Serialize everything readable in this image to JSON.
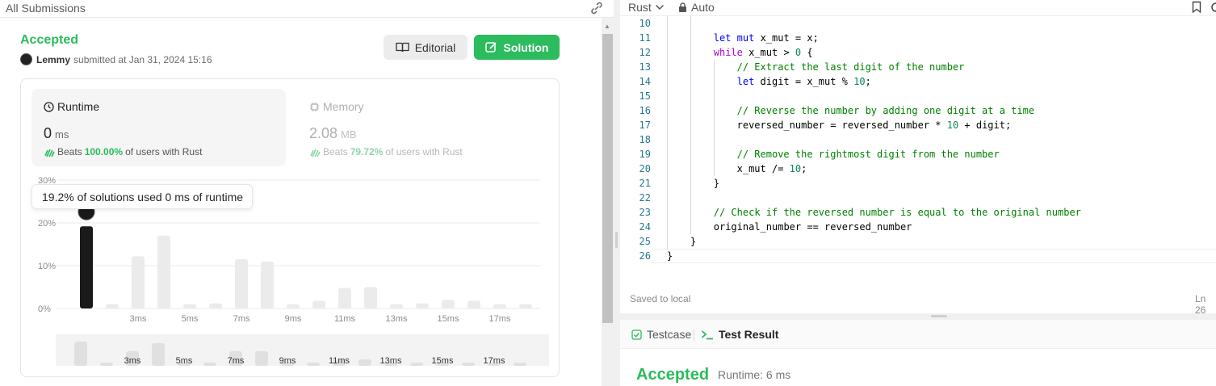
{
  "left_panel": {
    "header_title": "All Submissions",
    "status": "Accepted",
    "user_name": "Lemmy",
    "submitted_text": "submitted at Jan 31, 2024 15:16",
    "editorial_label": "Editorial",
    "solution_label": "Solution",
    "runtime": {
      "heading": "Runtime",
      "value": "0",
      "unit": "ms",
      "beats_prefix": "Beats",
      "beats_pct": "100.00%",
      "beats_suffix": "of users with Rust"
    },
    "memory": {
      "heading": "Memory",
      "value": "2.08",
      "unit": "MB",
      "beats_prefix": "Beats",
      "beats_pct": "79.72%",
      "beats_suffix": "of users with Rust"
    },
    "tooltip": "19.2% of solutions used 0 ms of runtime"
  },
  "chart_data": {
    "type": "bar",
    "yaxis_labels": [
      "30%",
      "20%",
      "10%",
      "0%"
    ],
    "ylim": [
      0,
      30
    ],
    "x": [
      0,
      1,
      2,
      3,
      4,
      5,
      6,
      7,
      8,
      9,
      10,
      11,
      12,
      13,
      14,
      15,
      16,
      17
    ],
    "x_tick_labels": [
      "3ms",
      "5ms",
      "7ms",
      "9ms",
      "11ms",
      "13ms",
      "15ms",
      "17ms"
    ],
    "values": [
      19.2,
      1.0,
      12.2,
      17.0,
      1.0,
      1.2,
      11.5,
      11.0,
      1.0,
      1.8,
      4.8,
      5.0,
      1.0,
      1.2,
      2.0,
      1.8,
      1.0,
      1.0
    ],
    "highlighted_index": 0,
    "highlight_color": "#1a1a1a",
    "bar_color": "#ebebeb",
    "overview_values": [
      7.5,
      1.0,
      4.5,
      7.0,
      1.0,
      1.0,
      4.5,
      4.5,
      1.0,
      1.0,
      2.0,
      2.0,
      1.0,
      1.0,
      1.0,
      1.0,
      1.0,
      1.0
    ],
    "grid": true
  },
  "editor": {
    "language": "Rust",
    "mode": "Auto",
    "saved_text": "Saved to local",
    "cursor_text": "Ln 26",
    "lines": [
      {
        "n": "10",
        "indent": 0,
        "html": ""
      },
      {
        "n": "11",
        "indent": 2,
        "html": "<span class='kw'>let</span> <span class='kw'>mut</span> x_mut = x;"
      },
      {
        "n": "12",
        "indent": 2,
        "html": "<span class='ctl'>while</span> x_mut &gt; <span class='num'>0</span> {"
      },
      {
        "n": "13",
        "indent": 3,
        "html": "<span class='cmt'>// Extract the last digit of the number</span>"
      },
      {
        "n": "14",
        "indent": 3,
        "html": "<span class='kw'>let</span> digit = x_mut % <span class='num'>10</span>;"
      },
      {
        "n": "15",
        "indent": 0,
        "html": ""
      },
      {
        "n": "16",
        "indent": 3,
        "html": "<span class='cmt'>// Reverse the number by adding one digit at a time</span>"
      },
      {
        "n": "17",
        "indent": 3,
        "html": "reversed_number = reversed_number * <span class='num'>10</span> + digit;"
      },
      {
        "n": "18",
        "indent": 0,
        "html": ""
      },
      {
        "n": "19",
        "indent": 3,
        "html": "<span class='cmt'>// Remove the rightmost digit from the number</span>"
      },
      {
        "n": "20",
        "indent": 3,
        "html": "x_mut /= <span class='num'>10</span>;"
      },
      {
        "n": "21",
        "indent": 2,
        "html": "}"
      },
      {
        "n": "22",
        "indent": 0,
        "html": ""
      },
      {
        "n": "23",
        "indent": 2,
        "html": "<span class='cmt'>// Check if the reversed number is equal to the original number</span>"
      },
      {
        "n": "24",
        "indent": 2,
        "html": "original_number == reversed_number"
      },
      {
        "n": "25",
        "indent": 1,
        "html": "}"
      },
      {
        "n": "26",
        "indent": 0,
        "html": "}"
      }
    ]
  },
  "test_panel": {
    "tab_testcase": "Testcase",
    "tab_result": "Test Result",
    "status": "Accepted",
    "runtime_text": "Runtime: 6 ms"
  },
  "colors": {
    "accent": "#2cbb5d",
    "highlight_bar": "#1a1a1a"
  }
}
